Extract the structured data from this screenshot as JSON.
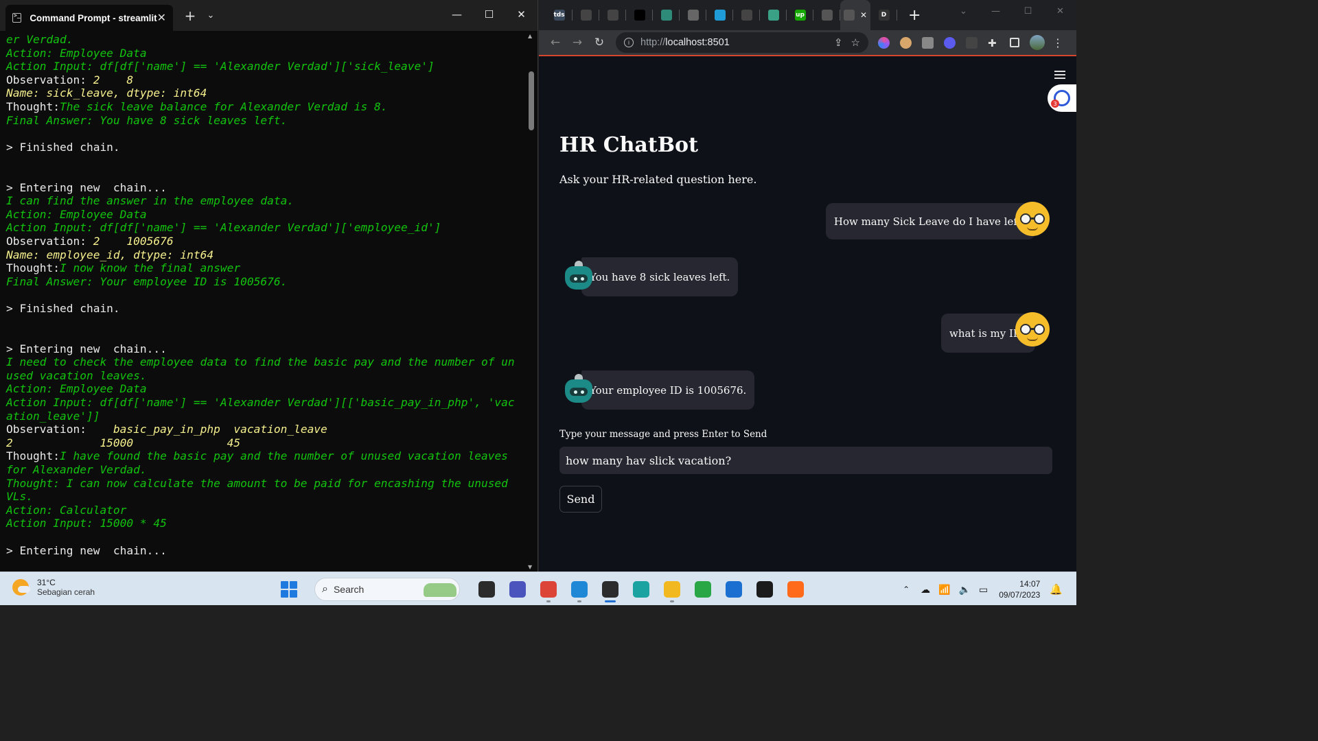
{
  "terminal": {
    "tab_title": "Command Prompt - streamlit",
    "lines": [
      [
        {
          "c": "g",
          "t": "er Verdad."
        }
      ],
      [
        {
          "c": "g",
          "t": "Action: Employee Data"
        }
      ],
      [
        {
          "c": "g",
          "t": "Action Input: df[df['name'] == 'Alexander Verdad']['sick_leave']"
        }
      ],
      [
        {
          "c": "w",
          "t": "Observation: "
        },
        {
          "c": "y",
          "t": "2    8"
        }
      ],
      [
        {
          "c": "y",
          "t": "Name: sick_leave, dtype: int64"
        }
      ],
      [
        {
          "c": "w",
          "t": "Thought:"
        },
        {
          "c": "g",
          "t": "The sick leave balance for Alexander Verdad is 8."
        }
      ],
      [
        {
          "c": "g",
          "t": "Final Answer: You have 8 sick leaves left."
        }
      ],
      [],
      [
        {
          "c": "w",
          "t": "> Finished chain."
        }
      ],
      [],
      [],
      [
        {
          "c": "w",
          "t": "> Entering new  chain..."
        }
      ],
      [
        {
          "c": "g",
          "t": "I can find the answer in the employee data."
        }
      ],
      [
        {
          "c": "g",
          "t": "Action: Employee Data"
        }
      ],
      [
        {
          "c": "g",
          "t": "Action Input: df[df['name'] == 'Alexander Verdad']['employee_id']"
        }
      ],
      [
        {
          "c": "w",
          "t": "Observation: "
        },
        {
          "c": "y",
          "t": "2    1005676"
        }
      ],
      [
        {
          "c": "y",
          "t": "Name: employee_id, dtype: int64"
        }
      ],
      [
        {
          "c": "w",
          "t": "Thought:"
        },
        {
          "c": "g",
          "t": "I now know the final answer"
        }
      ],
      [
        {
          "c": "g",
          "t": "Final Answer: Your employee ID is 1005676."
        }
      ],
      [],
      [
        {
          "c": "w",
          "t": "> Finished chain."
        }
      ],
      [],
      [],
      [
        {
          "c": "w",
          "t": "> Entering new  chain..."
        }
      ],
      [
        {
          "c": "g",
          "t": "I need to check the employee data to find the basic pay and the number of un"
        }
      ],
      [
        {
          "c": "g",
          "t": "used vacation leaves."
        }
      ],
      [
        {
          "c": "g",
          "t": "Action: Employee Data"
        }
      ],
      [
        {
          "c": "g",
          "t": "Action Input: df[df['name'] == 'Alexander Verdad'][['basic_pay_in_php', 'vac"
        }
      ],
      [
        {
          "c": "g",
          "t": "ation_leave']]"
        }
      ],
      [
        {
          "c": "w",
          "t": "Observation: "
        },
        {
          "c": "y",
          "t": "   basic_pay_in_php  vacation_leave"
        }
      ],
      [
        {
          "c": "y",
          "t": "2             15000              45"
        }
      ],
      [
        {
          "c": "w",
          "t": "Thought:"
        },
        {
          "c": "g",
          "t": "I have found the basic pay and the number of unused vacation leaves"
        }
      ],
      [
        {
          "c": "g",
          "t": "for Alexander Verdad."
        }
      ],
      [
        {
          "c": "g",
          "t": "Thought: I can now calculate the amount to be paid for encashing the unused"
        }
      ],
      [
        {
          "c": "g",
          "t": "VLs."
        }
      ],
      [
        {
          "c": "g",
          "t": "Action: Calculator"
        }
      ],
      [
        {
          "c": "g",
          "t": "Action Input: 15000 * 45"
        }
      ],
      [],
      [
        {
          "c": "w",
          "t": "> Entering new  chain..."
        }
      ]
    ]
  },
  "browser": {
    "url_scheme": "http://",
    "url_host": "localhost:8501",
    "tabs": [
      {
        "icon": "tds-icon",
        "label": "tds",
        "color": "#3a4a5c"
      },
      {
        "icon": "github-icon",
        "label": "",
        "color": "#444"
      },
      {
        "icon": "github-icon",
        "label": "",
        "color": "#444"
      },
      {
        "icon": "medium-icon",
        "label": "",
        "color": "#000"
      },
      {
        "icon": "bulb-icon",
        "label": "",
        "color": "#2e8b7a"
      },
      {
        "icon": "book-icon",
        "label": "",
        "color": "#666"
      },
      {
        "icon": "chat-icon",
        "label": "",
        "color": "#1f9bd8"
      },
      {
        "icon": "github-icon",
        "label": "",
        "color": "#444"
      },
      {
        "icon": "openai-icon",
        "label": "",
        "color": "#3aa186"
      },
      {
        "icon": "upwork-icon",
        "label": "up",
        "color": "#14a800"
      },
      {
        "icon": "gear-icon",
        "label": "",
        "color": "#555"
      },
      {
        "icon": "active-tab-icon",
        "label": "",
        "color": "#555"
      },
      {
        "icon": "d-icon",
        "label": "D",
        "color": "#333"
      }
    ]
  },
  "app": {
    "title": "HR ChatBot",
    "subtitle": "Ask your HR-related question here.",
    "messages": [
      {
        "role": "user",
        "text": "How many Sick Leave do I have left?"
      },
      {
        "role": "bot",
        "text": "You have 8 sick leaves left."
      },
      {
        "role": "user",
        "text": "what is my ID?"
      },
      {
        "role": "bot",
        "text": "Your employee ID is 1005676."
      }
    ],
    "input_label": "Type your message and press Enter to Send",
    "input_value": "how many hav slick vacation?",
    "send_label": "Send",
    "assistant_badge_count": "3"
  },
  "taskbar": {
    "weather_temp": "31°C",
    "weather_desc": "Sebagian cerah",
    "search_placeholder": "Search",
    "time": "14:07",
    "date": "09/07/2023",
    "apps": [
      {
        "name": "file-explorer-dark-icon",
        "color": "#2b2b2b",
        "run": false
      },
      {
        "name": "meet-icon",
        "color": "#4b53bc",
        "run": false
      },
      {
        "name": "chrome-icon",
        "color": "#db4437",
        "run": true
      },
      {
        "name": "vscode-icon",
        "color": "#1e88d6",
        "run": true
      },
      {
        "name": "terminal-icon",
        "color": "#2c2c2c",
        "run": true,
        "active": true
      },
      {
        "name": "edge-icon",
        "color": "#1aa3a0",
        "run": false
      },
      {
        "name": "folder-icon",
        "color": "#f2b820",
        "run": true
      },
      {
        "name": "refresh-app-icon",
        "color": "#29a645",
        "run": false
      },
      {
        "name": "store-icon",
        "color": "#1a6fd0",
        "run": false
      },
      {
        "name": "dropbox-icon",
        "color": "#1b1b1b",
        "run": false
      },
      {
        "name": "firefox-icon",
        "color": "#ff6a1b",
        "run": false
      }
    ]
  }
}
